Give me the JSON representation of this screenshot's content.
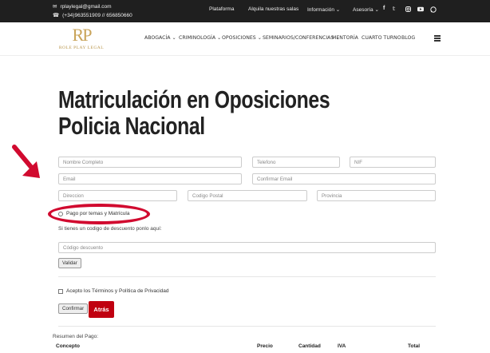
{
  "topbar": {
    "email": "rplaylegal@gmail.com",
    "phone": "(+34)963551909 // 656850660",
    "links": [
      {
        "label": "Plataforma"
      },
      {
        "label": "Alquila nuestras salas"
      },
      {
        "label": "Información"
      },
      {
        "label": "Asesoría"
      }
    ],
    "social": [
      "facebook-icon",
      "twitter-icon",
      "instagram-icon",
      "youtube-icon",
      "whatsapp-icon"
    ]
  },
  "header": {
    "logo_mark": "RP",
    "logo_text": "ROLE PLAY LEGAL",
    "nav": [
      {
        "label": "ABOGACÍA"
      },
      {
        "label": "CRIMINOLOGÍA"
      },
      {
        "label": "OPOSICIONES"
      },
      {
        "label": "SEMINARIOS/CONFERENCIAS"
      },
      {
        "label": "MENTORÍA"
      },
      {
        "label": "CUARTO TURNO"
      },
      {
        "label": "BLOG"
      }
    ]
  },
  "page_title": "Matriculación en Oposiciones Policia Nacional",
  "form": {
    "nombre": "Nombre Completo",
    "telefono": "Telefono",
    "nif": "NIF",
    "email": "Email",
    "confirmar_email": "Confirmar Email",
    "direccion": "Direccion",
    "codigo_postal": "Codigo Postal",
    "provincia": "Provincia",
    "pago_option": "Pago por temas y Matrícula",
    "discount_prompt": "Si tienes un codigo de descuento ponlo aquí:",
    "discount_placeholder": "Código descuento",
    "validar": "Validar",
    "terms": "Acepto los Términos y Política de Privacidad",
    "confirmar": "Confirmar",
    "atras": "Atrás"
  },
  "resumen": {
    "title": "Resumen del Pago:",
    "columns": [
      "Concepto",
      "Precio",
      "Cantidad",
      "IVA",
      "Total"
    ]
  },
  "colors": {
    "topbar": "#1f1f1f",
    "accent_red": "#c00010",
    "annotation_red": "#d10a2f",
    "logo_gold": "#c9a45a"
  }
}
